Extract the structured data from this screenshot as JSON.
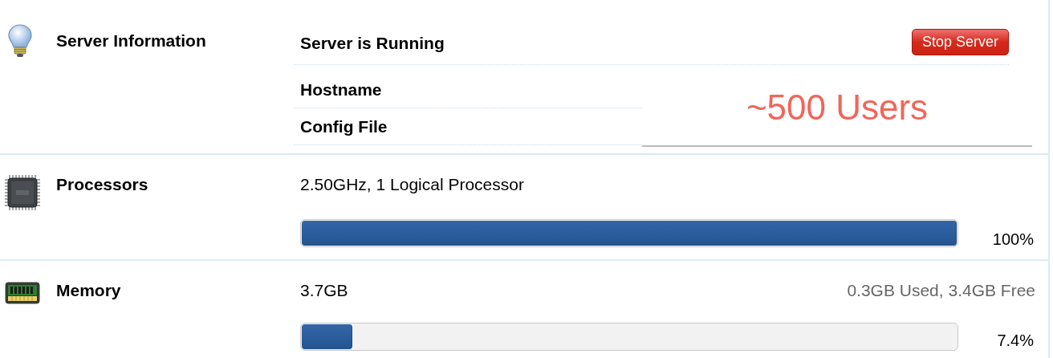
{
  "server": {
    "title": "Server Information",
    "status": "Server is Running",
    "button": "Stop Server",
    "rows": [
      "Hostname",
      "Config File"
    ],
    "overlay": "~500 Users"
  },
  "resources": [
    {
      "title": "Processors",
      "detail": "2.50GHz, 1 Logical Processor",
      "level": 1.0,
      "reading": "100%"
    },
    {
      "title": "Memory",
      "detail": "3.7GB",
      "note": "0.3GB Used, 3.4GB Free",
      "level": 0.077,
      "reading": "7.4%"
    }
  ]
}
